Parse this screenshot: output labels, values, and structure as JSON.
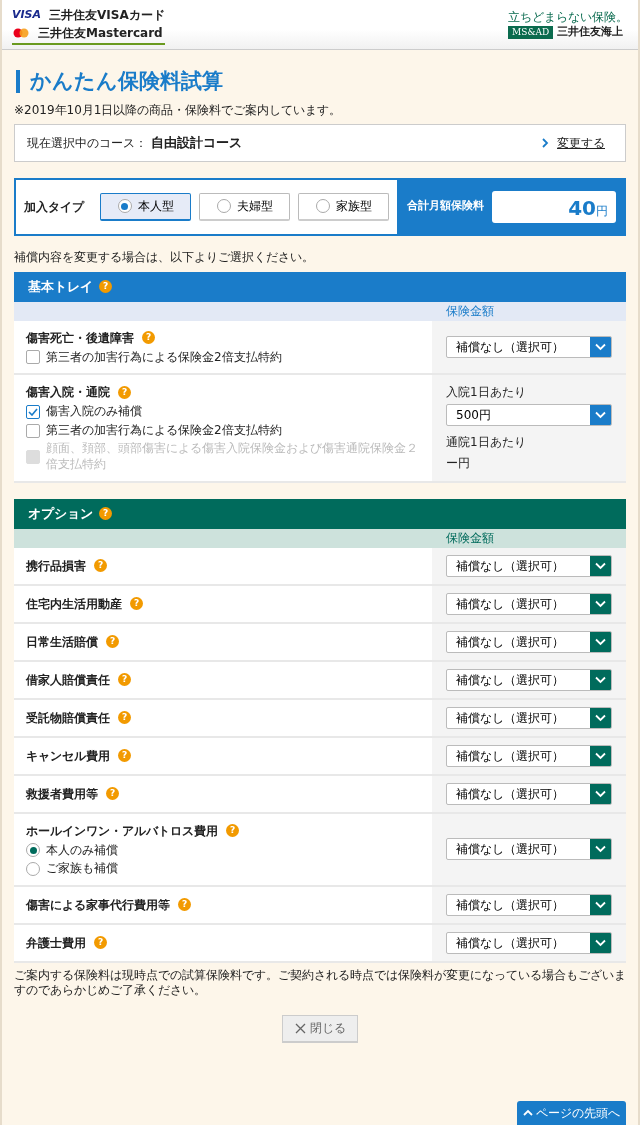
{
  "header": {
    "card_logo": {
      "brand": "VISA",
      "visa_name": "三井住友VISAカード",
      "mastercard_name": "三井住友Mastercard"
    },
    "insurer": {
      "tagline": "立ちどまらない保険。",
      "group": "MS&AD",
      "name": "三井住友海上"
    }
  },
  "title": "かんたん保険料試算",
  "note": "※2019年10月1日以降の商品・保険料でご案内しています。",
  "course": {
    "label": "現在選択中のコース：",
    "value": "自由設計コース",
    "link": "変更する"
  },
  "join_type": {
    "label": "加入タイプ",
    "options": [
      {
        "label": "本人型",
        "selected": true
      },
      {
        "label": "夫婦型",
        "selected": false
      },
      {
        "label": "家族型",
        "selected": false
      }
    ]
  },
  "total": {
    "label": "合計月額保険料",
    "amount": "40",
    "unit": "円"
  },
  "instruction": "補償内容を変更する場合は、以下よりご選択ください。",
  "sections": [
    {
      "kind": "basic",
      "title": "基本トレイ",
      "help": "?",
      "column_header": "保険金額",
      "rows": [
        {
          "name": "傷害死亡・後遺障害",
          "help": "?",
          "checkboxes": [
            {
              "label": "第三者の加害行為による保険金2倍支払特約",
              "checked": false,
              "disabled": false
            }
          ],
          "select": "補償なし（選択可）"
        },
        {
          "name": "傷害入院・通院",
          "help": "?",
          "checkboxes": [
            {
              "label": "傷害入院のみ補償",
              "checked": true,
              "disabled": false
            },
            {
              "label": "第三者の加害行為による保険金2倍支払特約",
              "checked": false,
              "disabled": false
            },
            {
              "label": "顔面、頚部、頭部傷害による傷害入院保険金および傷害通院保険金２倍支払特約",
              "checked": false,
              "disabled": true
            }
          ],
          "amount_label": "入院1日あたり",
          "select": "500円",
          "sub_label": "通院1日あたり",
          "sub_value": "ー円"
        }
      ]
    },
    {
      "kind": "option",
      "title": "オプション",
      "help": "?",
      "column_header": "保険金額",
      "rows": [
        {
          "name": "携行品損害",
          "help": "?",
          "select": "補償なし（選択可）"
        },
        {
          "name": "住宅内生活用動産",
          "help": "?",
          "select": "補償なし（選択可）"
        },
        {
          "name": "日常生活賠償",
          "help": "?",
          "select": "補償なし（選択可）"
        },
        {
          "name": "借家人賠償責任",
          "help": "?",
          "select": "補償なし（選択可）"
        },
        {
          "name": "受託物賠償責任",
          "help": "?",
          "select": "補償なし（選択可）"
        },
        {
          "name": "キャンセル費用",
          "help": "?",
          "select": "補償なし（選択可）"
        },
        {
          "name": "救援者費用等",
          "help": "?",
          "select": "補償なし（選択可）"
        },
        {
          "name": "ホールインワン・アルバトロス費用",
          "help": "?",
          "radios": [
            {
              "label": "本人のみ補償",
              "selected": true
            },
            {
              "label": "ご家族も補償",
              "selected": false
            }
          ],
          "select": "補償なし（選択可）"
        },
        {
          "name": "傷害による家事代行費用等",
          "help": "?",
          "select": "補償なし（選択可）"
        },
        {
          "name": "弁護士費用",
          "help": "?",
          "select": "補償なし（選択可）"
        }
      ]
    }
  ],
  "footnote": "ご案内する保険料は現時点での試算保険料です。ご契約される時点では保険料が変更になっている場合もございますのであらかじめご了承ください。",
  "close_button": "閉じる",
  "back_to_top": "ページの先頭へ"
}
